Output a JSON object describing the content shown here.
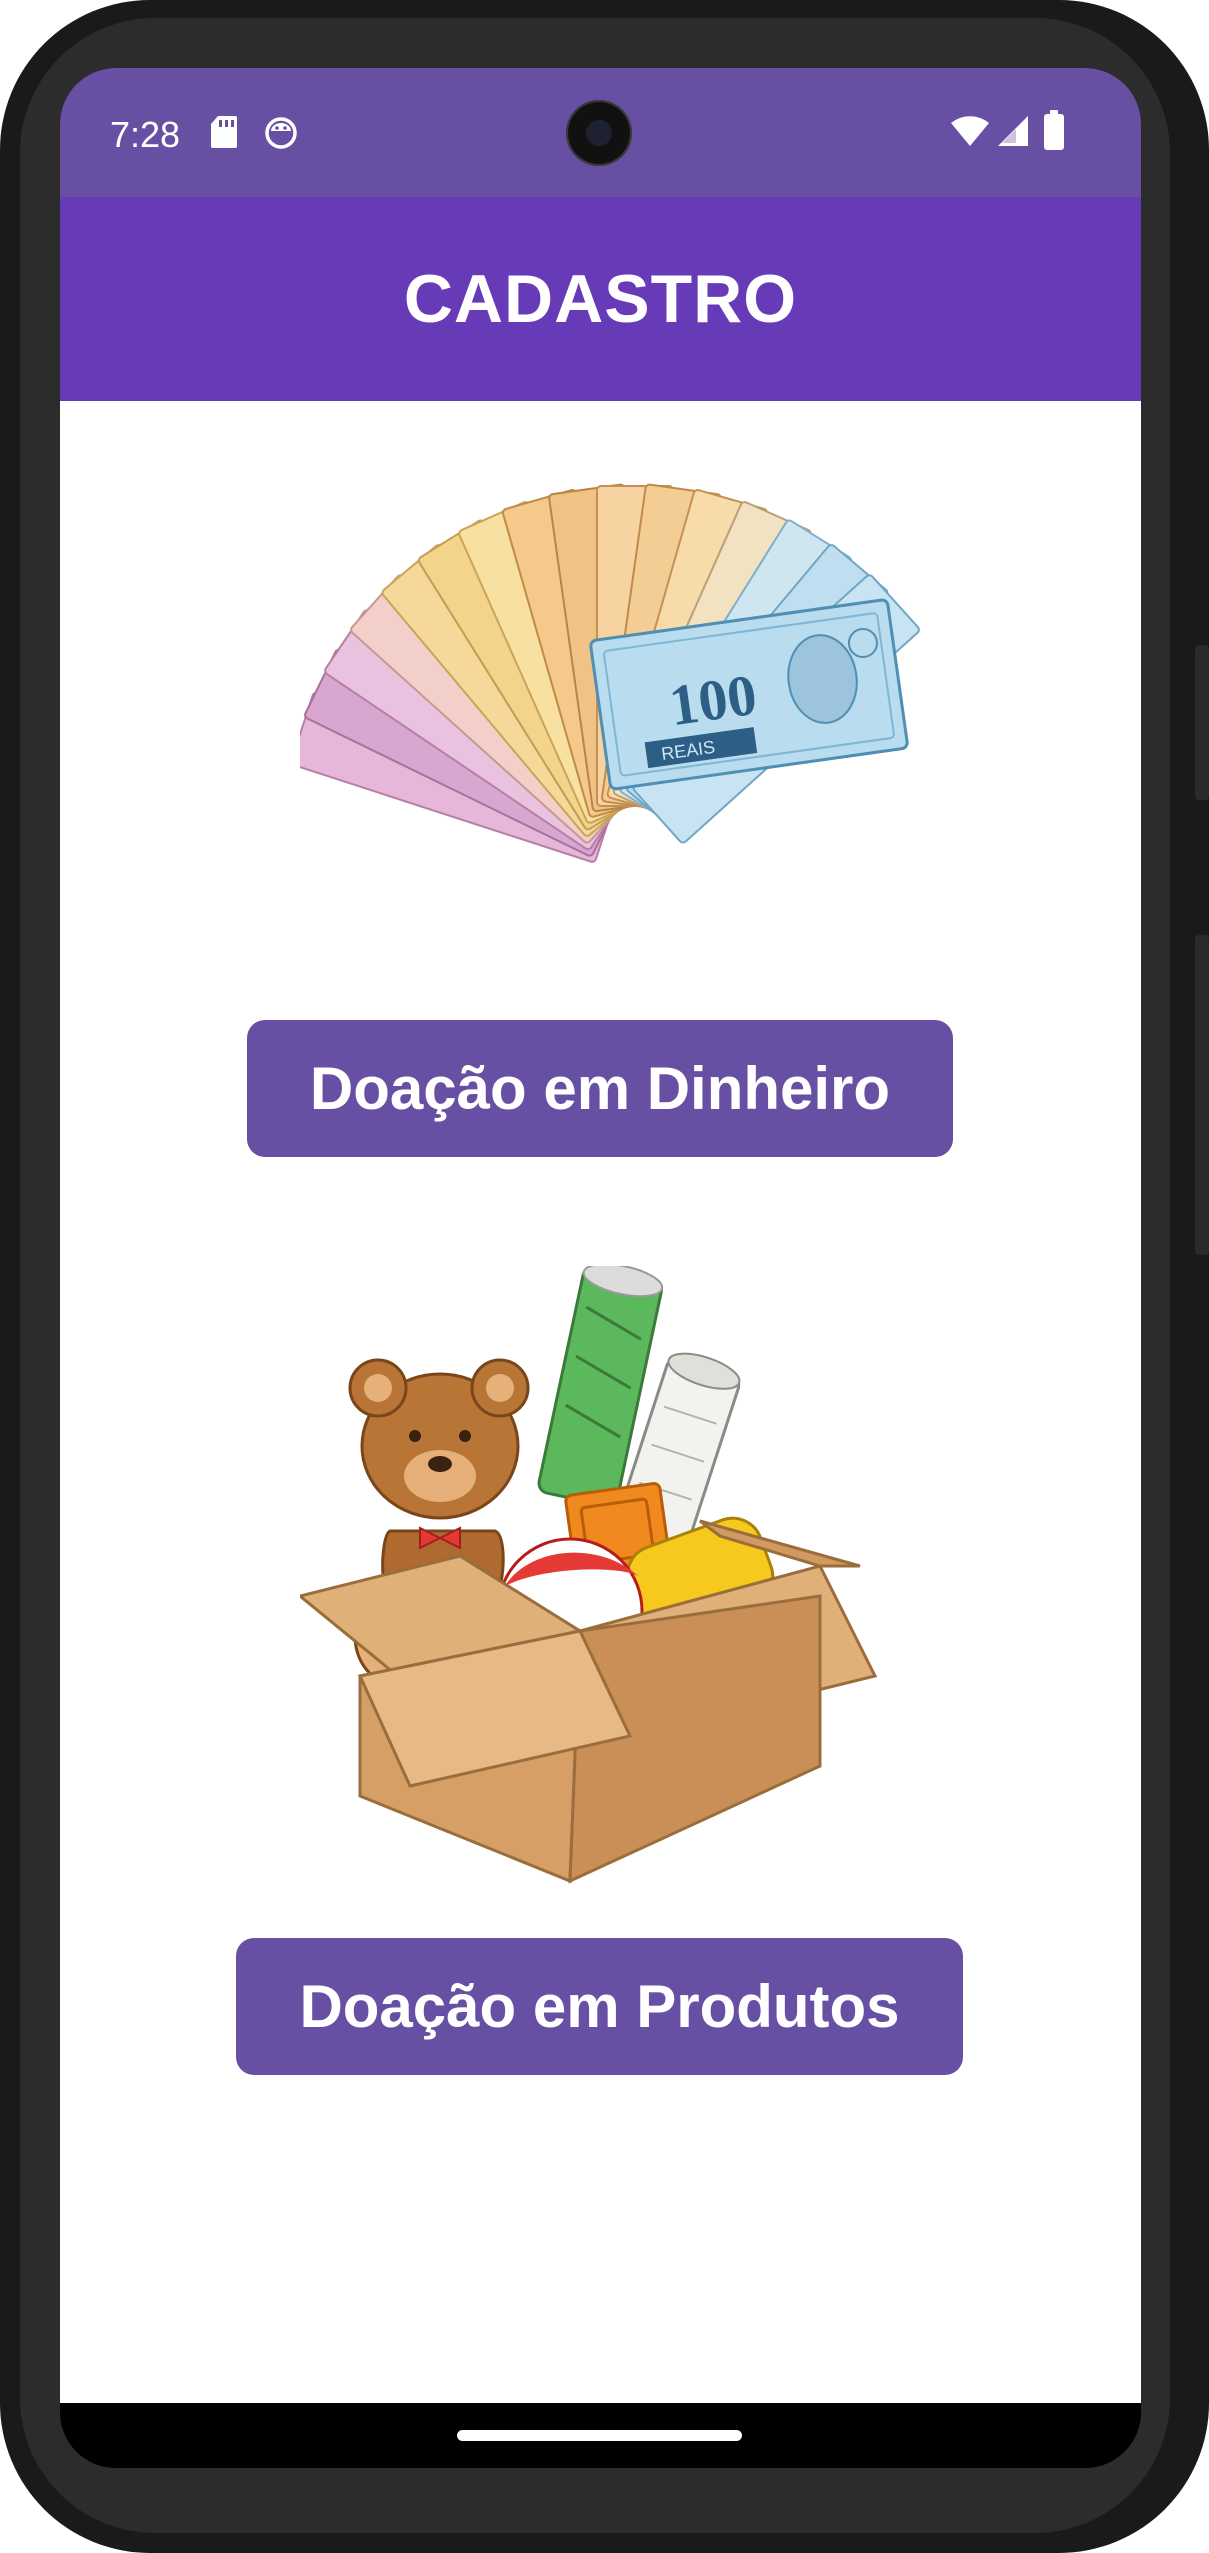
{
  "status_bar": {
    "time": "7:28",
    "left_icons": [
      "sd-card-icon",
      "android-debug-icon"
    ],
    "right_icons": [
      "wifi-icon",
      "cellular-signal-icon",
      "battery-icon"
    ]
  },
  "app_bar": {
    "title": "CADASTRO"
  },
  "main": {
    "money_image_icon": "money-fan-illustration",
    "money_button_label": "Doação em Dinheiro",
    "products_image_icon": "toy-box-illustration",
    "products_button_label": "Doação em Produtos"
  },
  "colors": {
    "status_bar": "#6750A4",
    "app_bar": "#673AB7",
    "button": "#6750A4",
    "background": "#FFFFFF"
  }
}
